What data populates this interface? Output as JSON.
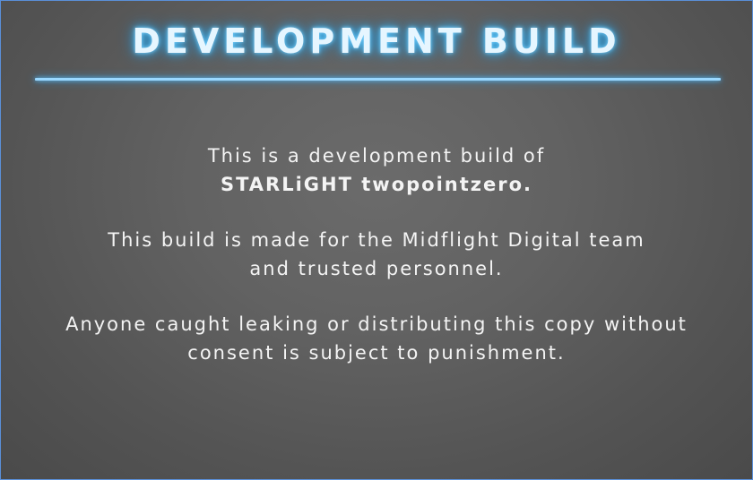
{
  "dialog": {
    "title": "DEVELOPMENT BUILD",
    "paragraphs": [
      {
        "line1": "This is a development build of",
        "line2_bold": "STARLiGHT twopointzero."
      },
      {
        "line1": "This build is made for the Midflight Digital team",
        "line2": "and trusted personnel."
      },
      {
        "line1": "Anyone caught leaking or distributing this copy without",
        "line2": "consent is subject to punishment."
      }
    ]
  },
  "colors": {
    "title_glow": "#3ab2f0",
    "divider": "#9ad8ff",
    "panel_border": "#5a8fd8",
    "background": "#626262",
    "text": "#f4f4f4"
  }
}
